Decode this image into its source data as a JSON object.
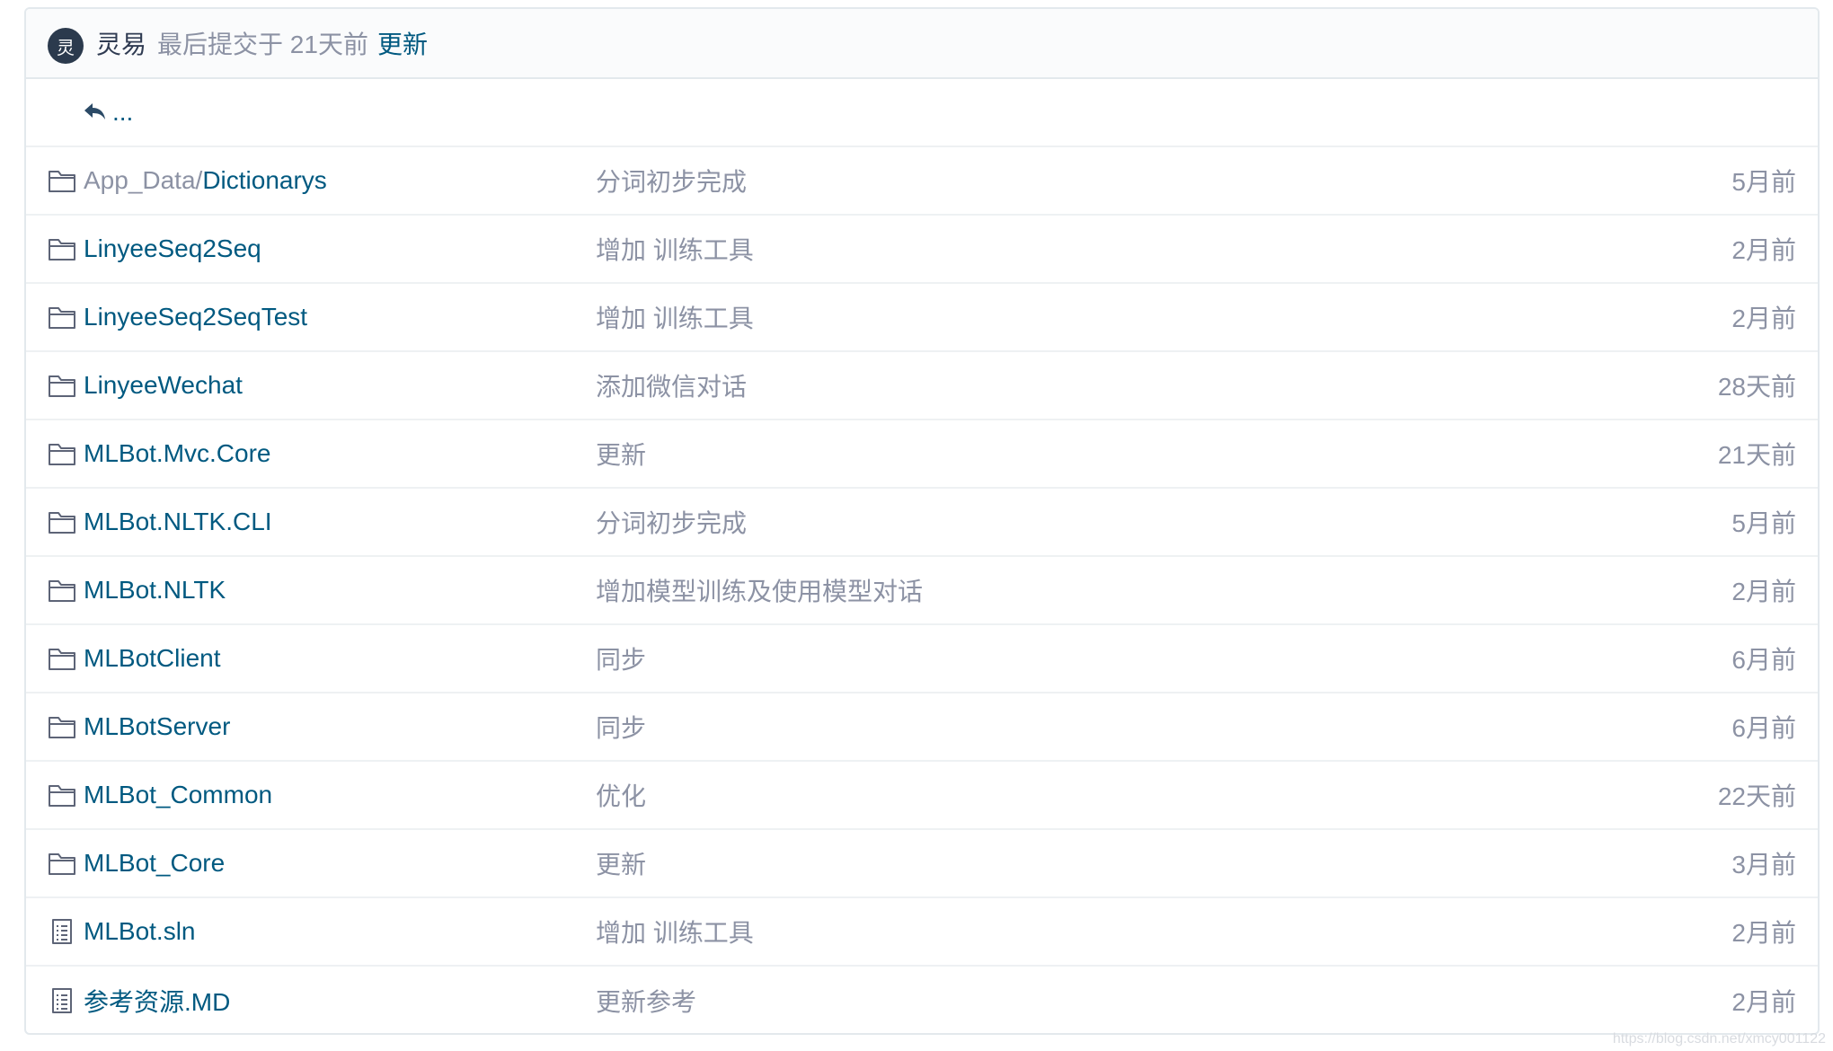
{
  "commit": {
    "avatar_initial": "灵",
    "author": "灵易",
    "meta": "最后提交于 21天前",
    "message": "更新"
  },
  "back": {
    "label": "..."
  },
  "rows": [
    {
      "type": "folder",
      "prefix": "App_Data/",
      "name": "Dictionarys",
      "message": "分词初步完成",
      "age": "5月前"
    },
    {
      "type": "folder",
      "prefix": "",
      "name": "LinyeeSeq2Seq",
      "message": "增加 训练工具",
      "age": "2月前"
    },
    {
      "type": "folder",
      "prefix": "",
      "name": "LinyeeSeq2SeqTest",
      "message": "增加 训练工具",
      "age": "2月前"
    },
    {
      "type": "folder",
      "prefix": "",
      "name": "LinyeeWechat",
      "message": "添加微信对话",
      "age": "28天前"
    },
    {
      "type": "folder",
      "prefix": "",
      "name": "MLBot.Mvc.Core",
      "message": "更新",
      "age": "21天前"
    },
    {
      "type": "folder",
      "prefix": "",
      "name": "MLBot.NLTK.CLI",
      "message": "分词初步完成",
      "age": "5月前"
    },
    {
      "type": "folder",
      "prefix": "",
      "name": "MLBot.NLTK",
      "message": "增加模型训练及使用模型对话",
      "age": "2月前"
    },
    {
      "type": "folder",
      "prefix": "",
      "name": "MLBotClient",
      "message": "同步",
      "age": "6月前"
    },
    {
      "type": "folder",
      "prefix": "",
      "name": "MLBotServer",
      "message": "同步",
      "age": "6月前"
    },
    {
      "type": "folder",
      "prefix": "",
      "name": "MLBot_Common",
      "message": "优化",
      "age": "22天前"
    },
    {
      "type": "folder",
      "prefix": "",
      "name": "MLBot_Core",
      "message": "更新",
      "age": "3月前"
    },
    {
      "type": "file",
      "prefix": "",
      "name": "MLBot.sln",
      "message": "增加 训练工具",
      "age": "2月前"
    },
    {
      "type": "file",
      "prefix": "",
      "name": "参考资源.MD",
      "message": "更新参考",
      "age": "2月前"
    }
  ],
  "watermark": "https://blog.csdn.net/xmcy001122",
  "colors": {
    "link": "#005980",
    "muted": "#8c92a4",
    "border": "#e3e9ed",
    "avatar_bg": "#2b3a4d"
  },
  "icons": {
    "folder": "folder-icon",
    "file": "file-text-icon",
    "back": "reply-arrow-icon"
  }
}
